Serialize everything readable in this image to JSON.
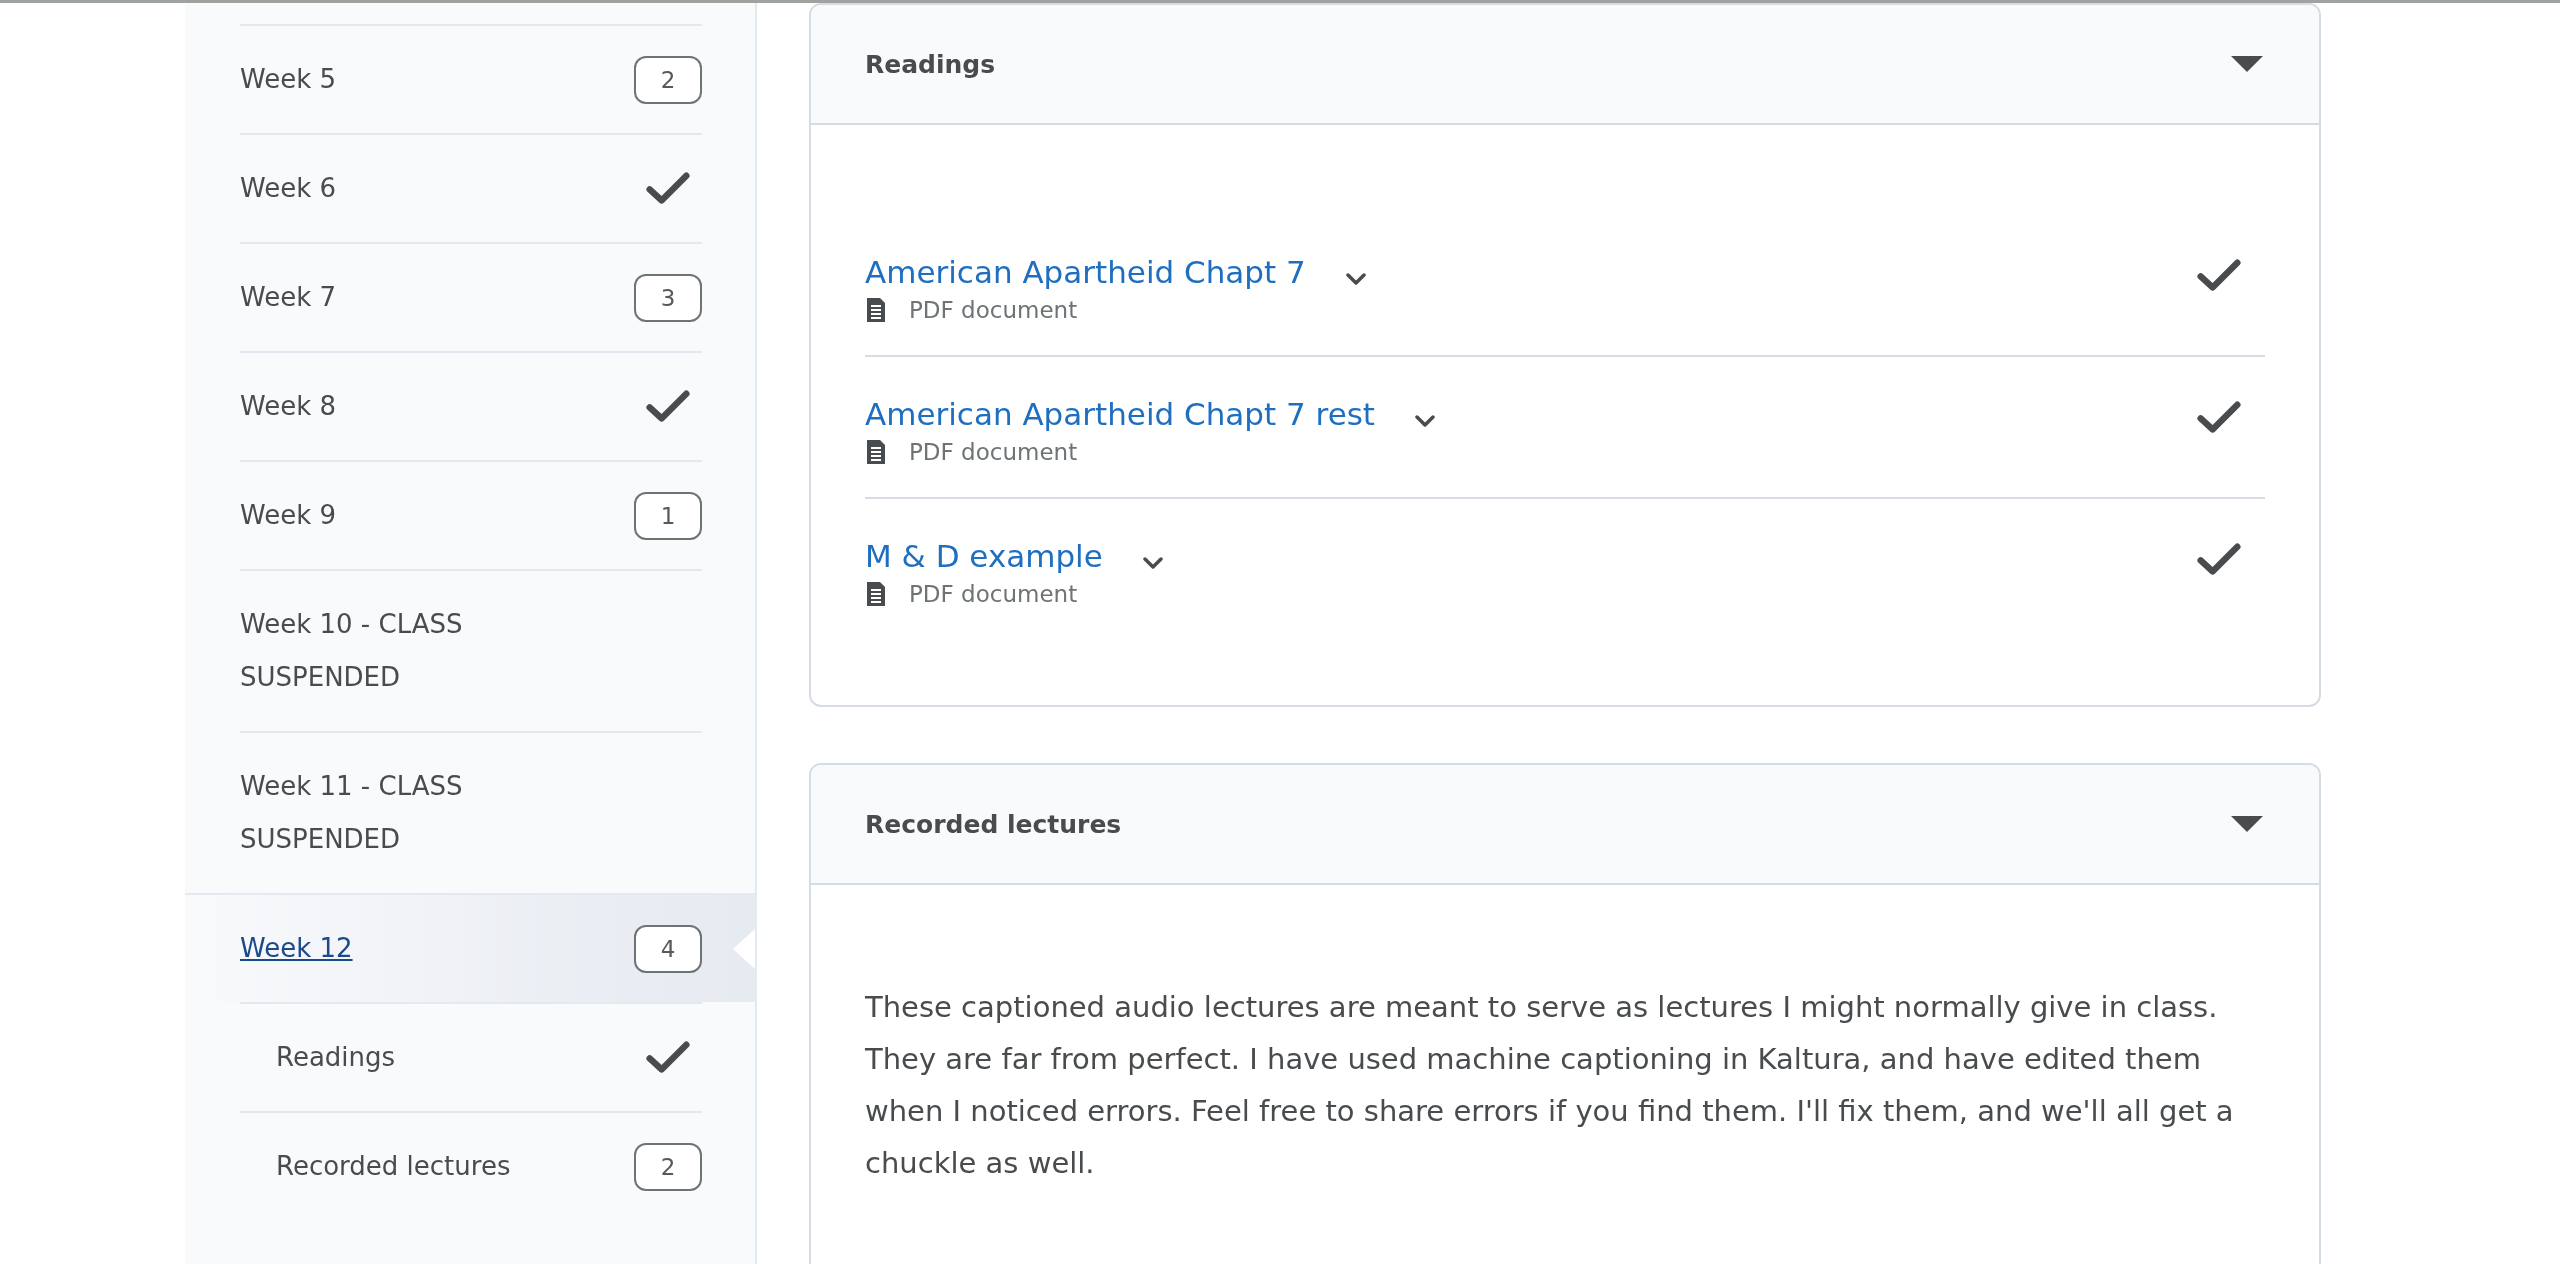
{
  "sidebar": {
    "items": [
      {
        "label": "Week 5",
        "selected": false,
        "status": {
          "kind": "count",
          "text": "2"
        }
      },
      {
        "label": "Week 6",
        "selected": false,
        "status": {
          "kind": "check"
        }
      },
      {
        "label": "Week 7",
        "selected": false,
        "status": {
          "kind": "count",
          "text": "3"
        }
      },
      {
        "label": "Week 8",
        "selected": false,
        "status": {
          "kind": "check"
        }
      },
      {
        "label": "Week 9",
        "selected": false,
        "status": {
          "kind": "count",
          "text": "1"
        }
      },
      {
        "label": "Week 10 - CLASS SUSPENDED",
        "selected": false
      },
      {
        "label": "Week 11 - CLASS SUSPENDED",
        "selected": false
      },
      {
        "label": "Week 12",
        "selected": true,
        "status": {
          "kind": "count",
          "text": "4"
        },
        "children": [
          {
            "label": "Readings",
            "selected": false,
            "status": {
              "kind": "check"
            }
          },
          {
            "label": "Recorded lectures",
            "selected": false,
            "status": {
              "kind": "count",
              "text": "2"
            }
          }
        ]
      }
    ]
  },
  "sections": [
    {
      "title": "Readings",
      "expanded": true,
      "items": [
        {
          "title": "American Apartheid Chapt 7",
          "type": "PDF document",
          "completed": true
        },
        {
          "title": "American Apartheid Chapt 7 rest",
          "type": "PDF document",
          "completed": true
        },
        {
          "title": "M & D example",
          "type": "PDF document",
          "completed": true
        }
      ]
    },
    {
      "title": "Recorded lectures",
      "expanded": true,
      "description": "These captioned audio lectures are meant to serve as lectures I might normally give in class. They are far from perfect. I have used machine captioning in Kaltura, and have edited them when I noticed errors. Feel free to share errors if you find them. I'll fix them, and we'll all get a chuckle as well."
    }
  ]
}
